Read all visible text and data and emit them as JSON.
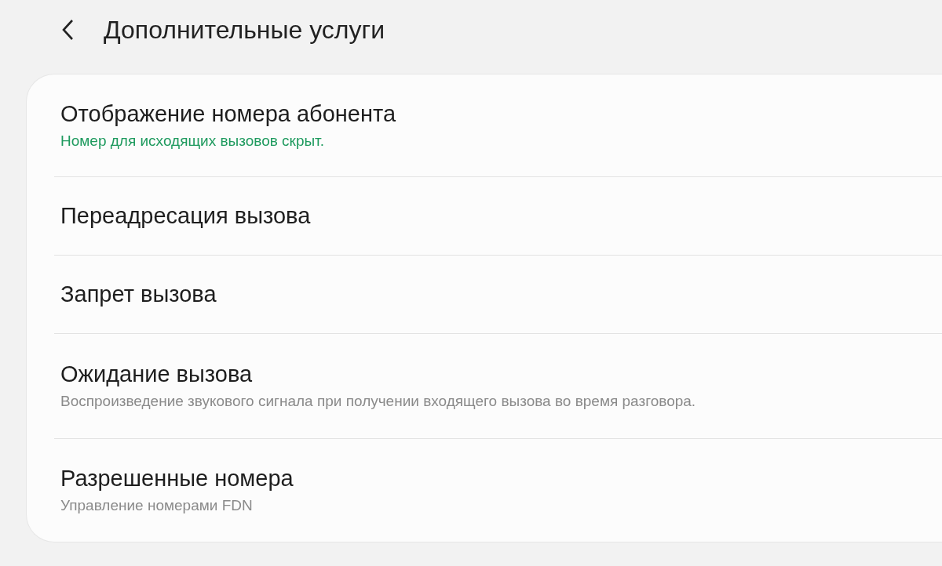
{
  "header": {
    "title": "Дополнительные услуги"
  },
  "items": [
    {
      "title": "Отображение номера абонента",
      "subtitle": "Номер для исходящих вызовов скрыт.",
      "kind": "status"
    },
    {
      "title": "Переадресация вызова"
    },
    {
      "title": "Запрет вызова"
    },
    {
      "title": "Ожидание вызова",
      "subtitle": "Воспроизведение звукового сигнала при получении входящего вызова во время разговора.",
      "kind": "description"
    },
    {
      "title": "Разрешенные номера",
      "subtitle": "Управление номерами FDN",
      "kind": "description"
    }
  ]
}
